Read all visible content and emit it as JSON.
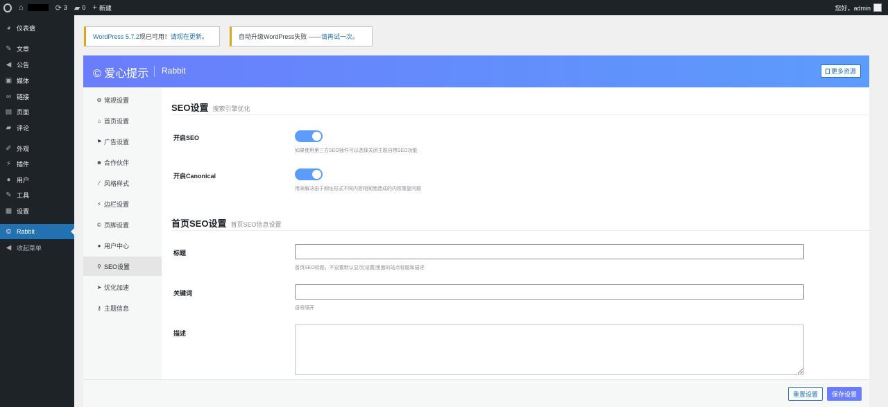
{
  "adminbar": {
    "updates_count": "3",
    "comments_count": "0",
    "new_label": "新建",
    "greeting": "您好，admin"
  },
  "sidebar": {
    "items": [
      {
        "label": "仪表盘",
        "icon": "dashboard-icon",
        "glyph": "◕"
      },
      {
        "label": "文章",
        "icon": "pin-icon",
        "glyph": "✎"
      },
      {
        "label": "公告",
        "icon": "megaphone-icon",
        "glyph": "📢"
      },
      {
        "label": "媒体",
        "icon": "media-icon",
        "glyph": "▣"
      },
      {
        "label": "链接",
        "icon": "link-icon",
        "glyph": "∞"
      },
      {
        "label": "页面",
        "icon": "page-icon",
        "glyph": "▤"
      },
      {
        "label": "评论",
        "icon": "comment-icon",
        "glyph": "▰"
      },
      {
        "label": "外观",
        "icon": "brush-icon",
        "glyph": "✐"
      },
      {
        "label": "插件",
        "icon": "plugin-icon",
        "glyph": "⚡"
      },
      {
        "label": "用户",
        "icon": "user-icon",
        "glyph": "●"
      },
      {
        "label": "工具",
        "icon": "wrench-icon",
        "glyph": "✗"
      },
      {
        "label": "设置",
        "icon": "settings-icon",
        "glyph": "▦"
      },
      {
        "label": "Rabbit",
        "icon": "copyright-icon",
        "glyph": "©"
      },
      {
        "label": "收起菜单",
        "icon": "collapse-icon",
        "glyph": "◀"
      }
    ]
  },
  "notices": {
    "update_text": "WordPress 5.7.2",
    "update_mid": "现已可用！",
    "update_link": "请现在更新",
    "update_end": "。",
    "upgrade_text": "自动升级WordPress失败 —— ",
    "upgrade_link": "请再试一次",
    "upgrade_end": "。"
  },
  "panel": {
    "brand": "© 爱心提示",
    "brand_sub": "Rabbit",
    "more_button": "更多资源",
    "nav": [
      {
        "label": "常规设置",
        "icon": "gear-icon",
        "glyph": "⚙"
      },
      {
        "label": "首页设置",
        "icon": "home-icon",
        "glyph": "⌂"
      },
      {
        "label": "广告设置",
        "icon": "flag-icon",
        "glyph": "⚑"
      },
      {
        "label": "合作伙伴",
        "icon": "users-icon",
        "glyph": "☻"
      },
      {
        "label": "风格样式",
        "icon": "magic-icon",
        "glyph": "⁄"
      },
      {
        "label": "边栏设置",
        "icon": "plug-icon",
        "glyph": "⚡"
      },
      {
        "label": "页脚设置",
        "icon": "copyright-icon",
        "glyph": "©"
      },
      {
        "label": "用户中心",
        "icon": "user-icon",
        "glyph": "●"
      },
      {
        "label": "SEO设置",
        "icon": "search-icon",
        "glyph": "⚲"
      },
      {
        "label": "优化加速",
        "icon": "rocket-icon",
        "glyph": "➤"
      },
      {
        "label": "主题信息",
        "icon": "key-icon",
        "glyph": "⚷"
      }
    ],
    "seo": {
      "title": "SEO设置",
      "subtitle": "搜索引擎优化",
      "enable_seo_label": "开启SEO",
      "enable_seo_desc": "如果使用第三方SEO插件可以选择关闭主题自带SEO功能",
      "enable_seo_on": true,
      "canonical_label": "开启Canonical",
      "canonical_desc": "用来解决由于网址形式不同内容相同而造成的内容重复问题",
      "canonical_on": true
    },
    "home_seo": {
      "title": "首页SEO设置",
      "subtitle": "首页SEO信息设置",
      "title_label": "标题",
      "title_value": "",
      "title_desc": "首页SEO标题，不设置默认显示[设置]里面的站点标题和描述",
      "keywords_label": "关键词",
      "keywords_value": "",
      "keywords_desc": "逗号隔开",
      "description_label": "描述",
      "description_value": ""
    },
    "footer": {
      "reset_button": "重置设置",
      "save_button": "保存设置"
    }
  },
  "colors": {
    "accent": "#6a7dfc",
    "toggle_on": "#5c9cfc",
    "wp_blue": "#2271b1",
    "admin_dark": "#1d2327"
  }
}
